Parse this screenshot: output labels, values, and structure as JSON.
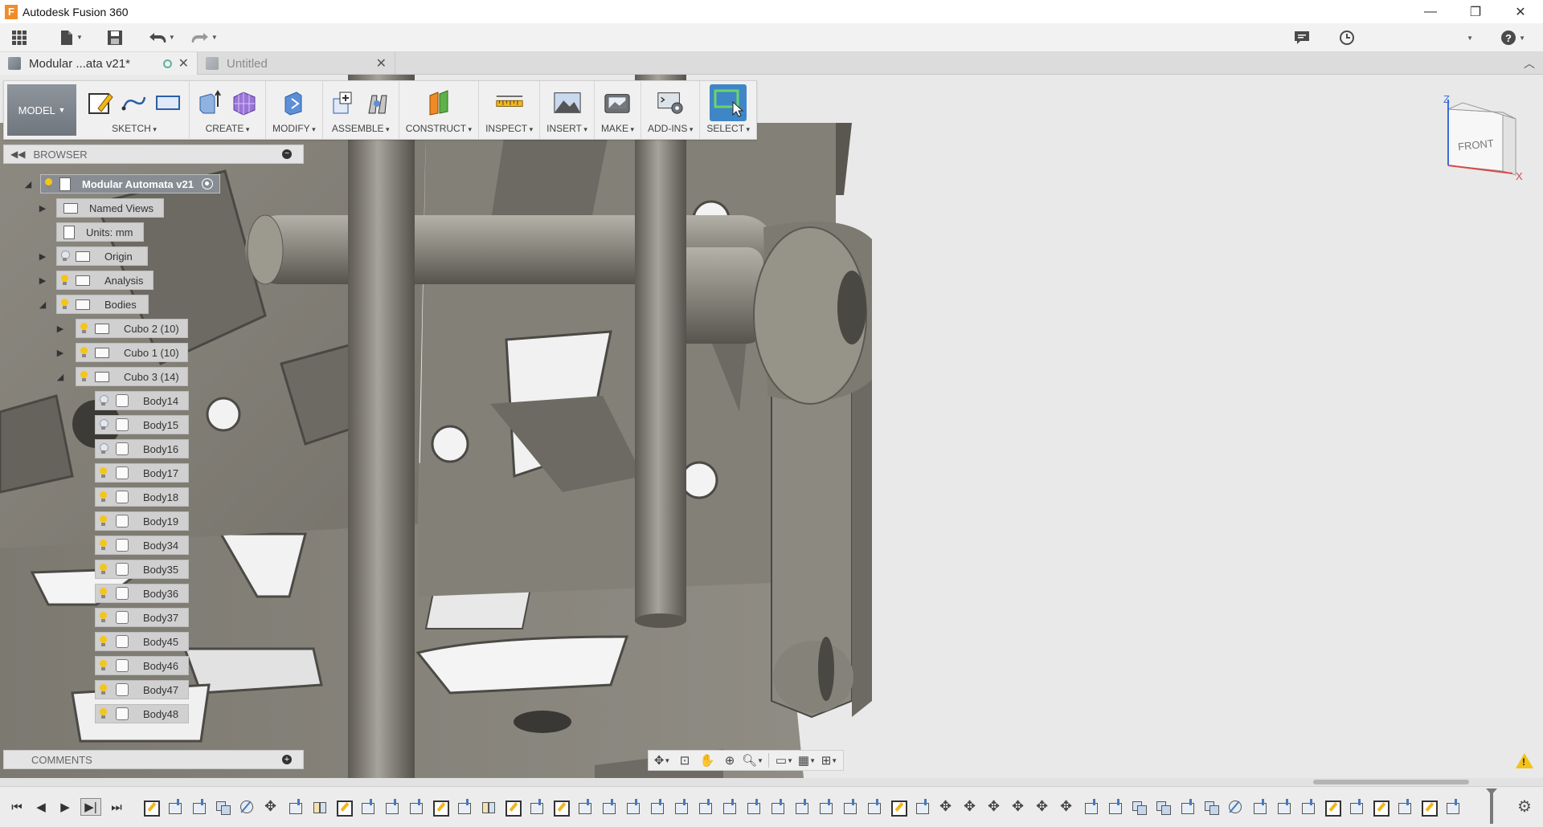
{
  "window": {
    "title": "Autodesk Fusion 360",
    "logo_letter": "F",
    "minimize": "—",
    "restore": "❐",
    "close": "✕"
  },
  "quick_access": {
    "icons": [
      "grid-icon",
      "file-icon",
      "save-icon",
      "undo-icon",
      "redo-icon"
    ],
    "right_icons": [
      "notification-icon",
      "clock-icon",
      "account-dropdown",
      "help-icon"
    ]
  },
  "tabs": [
    {
      "label": "Modular ...ata v21*",
      "active": true
    },
    {
      "label": "Untitled",
      "active": false
    }
  ],
  "ribbon": {
    "workspace": "MODEL",
    "groups": [
      {
        "label": "SKETCH"
      },
      {
        "label": "CREATE"
      },
      {
        "label": "MODIFY"
      },
      {
        "label": "ASSEMBLE"
      },
      {
        "label": "CONSTRUCT"
      },
      {
        "label": "INSPECT"
      },
      {
        "label": "INSERT"
      },
      {
        "label": "MAKE"
      },
      {
        "label": "ADD-INS"
      },
      {
        "label": "SELECT"
      }
    ]
  },
  "browser": {
    "title": "BROWSER",
    "root": "Modular Automata v21",
    "items": [
      {
        "label": "Named Views"
      },
      {
        "label": "Units: mm"
      },
      {
        "label": "Origin"
      },
      {
        "label": "Analysis"
      },
      {
        "label": "Bodies"
      },
      {
        "label": "Cubo 2 (10)"
      },
      {
        "label": "Cubo 1 (10)"
      },
      {
        "label": "Cubo 3 (14)"
      }
    ],
    "bodies": [
      "Body14",
      "Body15",
      "Body16",
      "Body17",
      "Body18",
      "Body19",
      "Body34",
      "Body35",
      "Body36",
      "Body37",
      "Body45",
      "Body46",
      "Body47",
      "Body48"
    ]
  },
  "comments": {
    "title": "COMMENTS"
  },
  "viewcube": {
    "face": "FRONT",
    "axis_z": "Z",
    "axis_x": "X"
  },
  "timeline": {
    "controls": [
      "⏮",
      "◀",
      "▶",
      "▶|",
      "⏭"
    ]
  },
  "colors": {
    "accent": "#3f86c6",
    "model_gray": "#8a877f",
    "background": "#e9e9e9",
    "bulb_on": "#f5c518"
  }
}
